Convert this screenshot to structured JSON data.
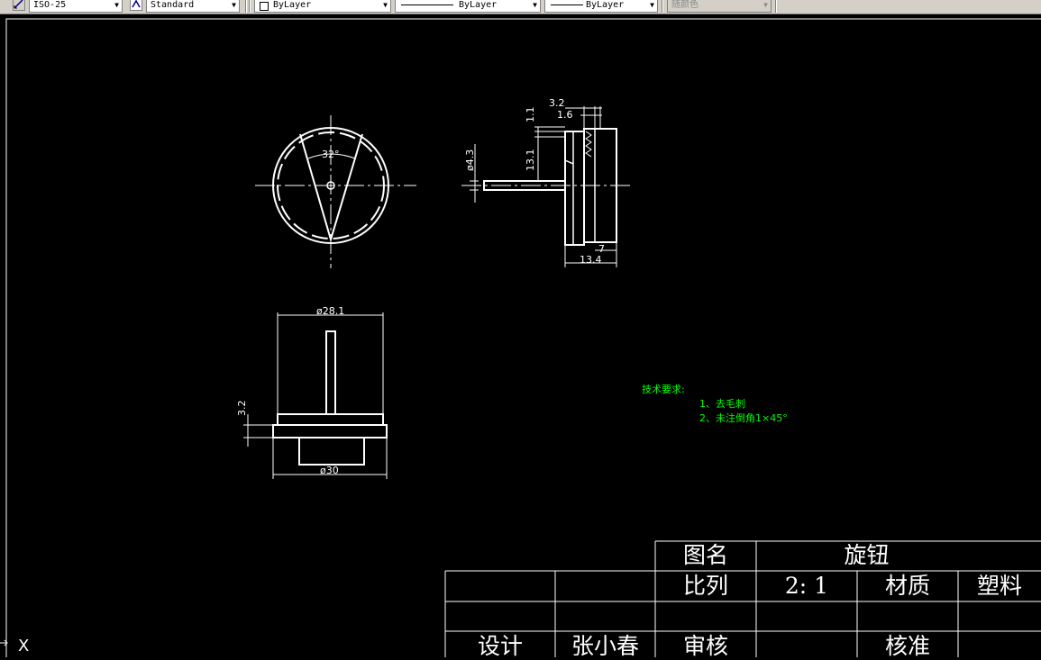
{
  "toolbar": {
    "dim_style": "ISO-25",
    "text_style": "Standard",
    "layer_color": "ByLayer",
    "linetype": "ByLayer",
    "lineweight": "ByLayer",
    "plot_style": "随颜色",
    "icons": [
      "dimstyle-icon",
      "textstyle-icon"
    ]
  },
  "drawing": {
    "angle_label": "32°",
    "dim_shaft_dia": "ø4.3",
    "dim_13_1": "13.1",
    "dim_1_1": "1.1",
    "dim_3_2_top": "3.2",
    "dim_1_6": "1.6",
    "dim_7": "7",
    "dim_13_4": "13.4",
    "dim_28_1": "ø28.1",
    "dim_3_2_left": "3.2",
    "dim_30": "ø30"
  },
  "notes": {
    "title": "技术要求:",
    "line1": "1、去毛刺",
    "line2": "2、未注倒角1×45°"
  },
  "title_block": {
    "label_name": "图名",
    "part_name": "旋钮",
    "label_scale": "比列",
    "scale": "2: 1",
    "label_material": "材质",
    "material": "塑料",
    "label_design": "设计",
    "designer": "张小春",
    "label_review": "审核",
    "label_approve": "核准"
  },
  "ucs": {
    "axis_x": "X"
  }
}
